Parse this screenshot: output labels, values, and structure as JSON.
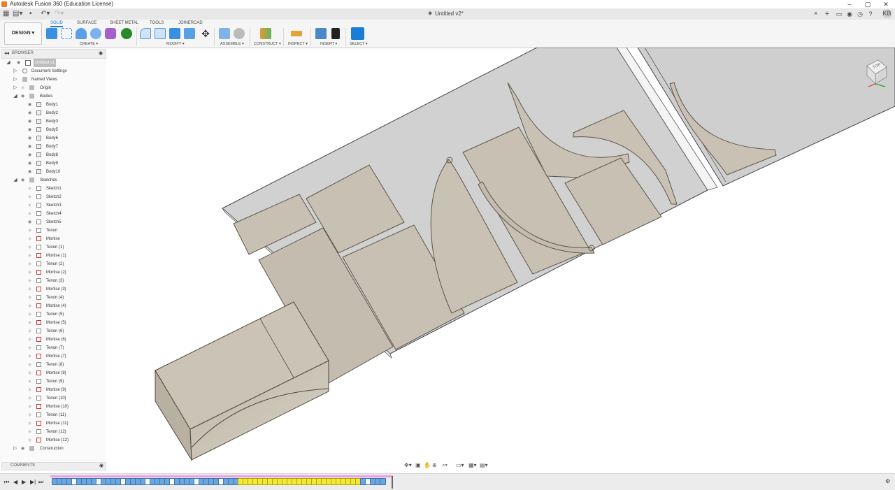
{
  "window": {
    "title": "Autodesk Fusion 360 (Education License)",
    "minimize": "–",
    "maximize": "▢",
    "close": "✕"
  },
  "document": {
    "tab_title": "Untitled v2*",
    "close_tab": "×",
    "new_tab": "+",
    "avatar_initials": "KB"
  },
  "workspace": {
    "switcher_label": "DESIGN ▾",
    "tabs": [
      "SOLID",
      "SURFACE",
      "SHEET METAL",
      "TOOLS",
      "JOINERCAD"
    ],
    "active_tab": "SOLID"
  },
  "toolbar_groups": {
    "create": "CREATE ▾",
    "modify": "MODIFY ▾",
    "assemble": "ASSEMBLE ▾",
    "construct": "CONSTRUCT ▾",
    "inspect": "INSPECT ▾",
    "insert": "INSERT ▾",
    "select": "SELECT ▾"
  },
  "browser": {
    "header": "BROWSER",
    "root": "Untitled v1",
    "document_settings": "Document Settings",
    "named_views": "Named Views",
    "origin": "Origin",
    "bodies_folder": "Bodies",
    "bodies": [
      "Body1",
      "Body2",
      "Body3",
      "Body5",
      "Body6",
      "Body7",
      "Body8",
      "Body9",
      "Body10"
    ],
    "sketches_folder": "Sketches",
    "sketches": [
      "Sketch1",
      "Sketch2",
      "Sketch3",
      "Sketch4",
      "Sketch5",
      "Tenon",
      "Mortise",
      "Tenon (1)",
      "Mortise (1)",
      "Tenon (2)",
      "Mortise (2)",
      "Tenon (3)",
      "Mortise (3)",
      "Tenon (4)",
      "Mortise (4)",
      "Tenon (5)",
      "Mortise (5)",
      "Tenon (6)",
      "Mortise (6)",
      "Tenon (7)",
      "Mortise (7)",
      "Tenon (8)",
      "Mortise (8)",
      "Tenon (9)",
      "Mortise (9)",
      "Tenon (10)",
      "Mortise (10)",
      "Tenon (11)",
      "Mortise (11)",
      "Tenon (12)",
      "Mortise (12)"
    ],
    "construction": "Construction"
  },
  "comments": {
    "label": "COMMENTS"
  },
  "viewcube": {
    "face_label": "TOP"
  },
  "colors": {
    "accent": "#1a7dd6",
    "part_fill": "#cdc6b9",
    "part_stroke": "#5b554b",
    "plate_fill": "#d3d3d3",
    "timeline_pink": "#e8a0e8",
    "timeline_yellow": "#f3e83a",
    "timeline_blue": "#6aa6e0"
  }
}
